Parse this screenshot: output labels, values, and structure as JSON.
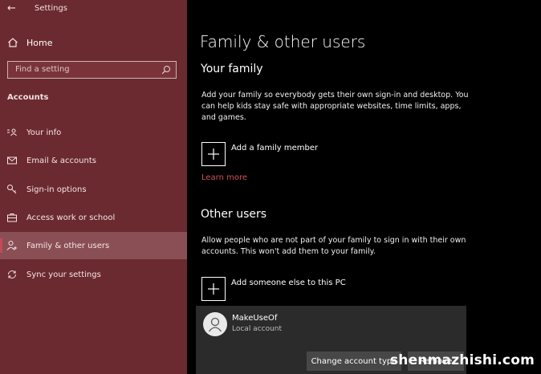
{
  "app": {
    "title": "Settings",
    "back_icon": "back-arrow-icon"
  },
  "sidebar": {
    "home_label": "Home",
    "search_placeholder": "Find a setting",
    "section_title": "Accounts",
    "items": [
      {
        "label": "Your info",
        "icon": "contact-card-icon",
        "active": false
      },
      {
        "label": "Email & accounts",
        "icon": "mail-icon",
        "active": false
      },
      {
        "label": "Sign-in options",
        "icon": "key-icon",
        "active": false
      },
      {
        "label": "Access work or school",
        "icon": "briefcase-icon",
        "active": false
      },
      {
        "label": "Family & other users",
        "icon": "person-add-icon",
        "active": true
      },
      {
        "label": "Sync your settings",
        "icon": "sync-icon",
        "active": false
      }
    ]
  },
  "main": {
    "title": "Family & other users",
    "your_family": {
      "heading": "Your family",
      "description": "Add your family so everybody gets their own sign-in and desktop. You can help kids stay safe with appropriate websites, time limits, apps, and games.",
      "add_label": "Add a family member",
      "learn_more": "Learn more"
    },
    "other_users": {
      "heading": "Other users",
      "description": "Allow people who are not part of your family to sign in with their own accounts. This won't add them to your family.",
      "add_label": "Add someone else to this PC",
      "user": {
        "name": "MakeUseOf",
        "type": "Local account",
        "change_button": "Change account type",
        "remove_button": "Remove"
      }
    }
  },
  "watermark": "shenmazhishi.com",
  "colors": {
    "sidebar_bg": "#6b2a2f",
    "accent": "#d1505b",
    "main_bg": "#000000"
  }
}
